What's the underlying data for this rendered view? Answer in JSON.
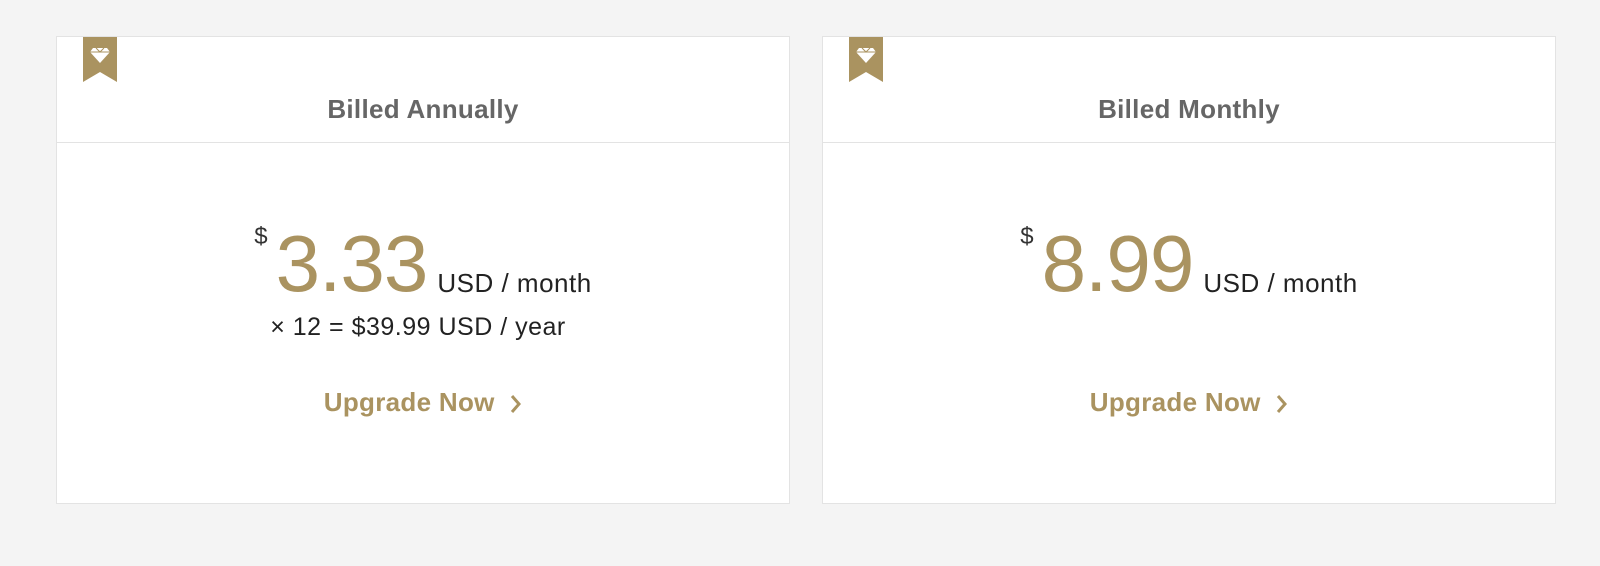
{
  "plans": [
    {
      "title": "Billed Annually",
      "currency_symbol": "$",
      "amount": "3.33",
      "unit": "USD / month",
      "yearly_note": "× 12 = $39.99 USD / year",
      "cta_label": "Upgrade Now",
      "badge_icon": "diamond-ribbon-icon"
    },
    {
      "title": "Billed Monthly",
      "currency_symbol": "$",
      "amount": "8.99",
      "unit": "USD / month",
      "cta_label": "Upgrade Now",
      "badge_icon": "diamond-ribbon-icon"
    }
  ],
  "colors": {
    "accent": "#aa9360",
    "title": "#666666",
    "border": "#e3e3e3",
    "background": "#f4f4f4"
  }
}
